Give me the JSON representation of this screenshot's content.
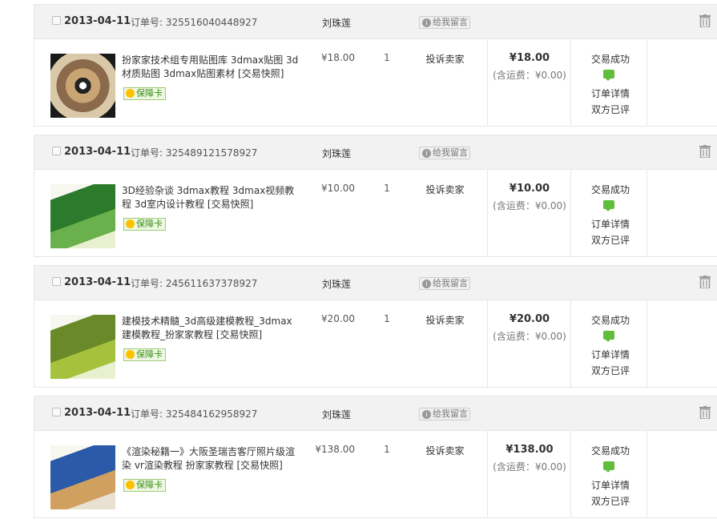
{
  "labels": {
    "order_prefix": "订单号:",
    "leave_message": "给我留言",
    "complain": "投诉卖家",
    "status": "交易成功",
    "order_detail": "订单详情",
    "both_rated": "双方已评",
    "warranty_badge": "保障卡"
  },
  "colors": {
    "header_bg": "#f2f2f2",
    "badge_green": "#3a8f1a",
    "chat_green": "#5fbf3b"
  },
  "icons": {
    "trash": "trash-icon",
    "message": "message-icon",
    "chat": "chat-bubble-icon",
    "badge": "coin-icon"
  },
  "orders": [
    {
      "date": "2013-04-11",
      "order_no": "325516040448927",
      "seller": "刘珠莲",
      "title": "扮家家技术组专用贴图库 3dmax贴图 3d材质贴图 3dmax贴图素材 [交易快照]",
      "unit_price": "¥18.00",
      "quantity": "1",
      "total": "¥18.00",
      "shipping": "(含运费：¥0.00)"
    },
    {
      "date": "2013-04-11",
      "order_no": "325489121578927",
      "seller": "刘珠莲",
      "title": "3D经验杂谈 3dmax教程 3dmax视频教程 3d室内设计教程 [交易快照]",
      "unit_price": "¥10.00",
      "quantity": "1",
      "total": "¥10.00",
      "shipping": "(含运费：¥0.00)"
    },
    {
      "date": "2013-04-11",
      "order_no": "245611637378927",
      "seller": "刘珠莲",
      "title": "建模技术精髓_3d高级建模教程_3dmax建模教程_扮家家教程 [交易快照]",
      "unit_price": "¥20.00",
      "quantity": "1",
      "total": "¥20.00",
      "shipping": "(含运费：¥0.00)"
    },
    {
      "date": "2013-04-11",
      "order_no": "325484162958927",
      "seller": "刘珠莲",
      "title": "《渲染秘籍一》大阪圣瑞吉客厅照片级渲染 vr渲染教程 扮家家教程 [交易快照]",
      "unit_price": "¥138.00",
      "quantity": "1",
      "total": "¥138.00",
      "shipping": "(含运费：¥0.00)"
    }
  ]
}
